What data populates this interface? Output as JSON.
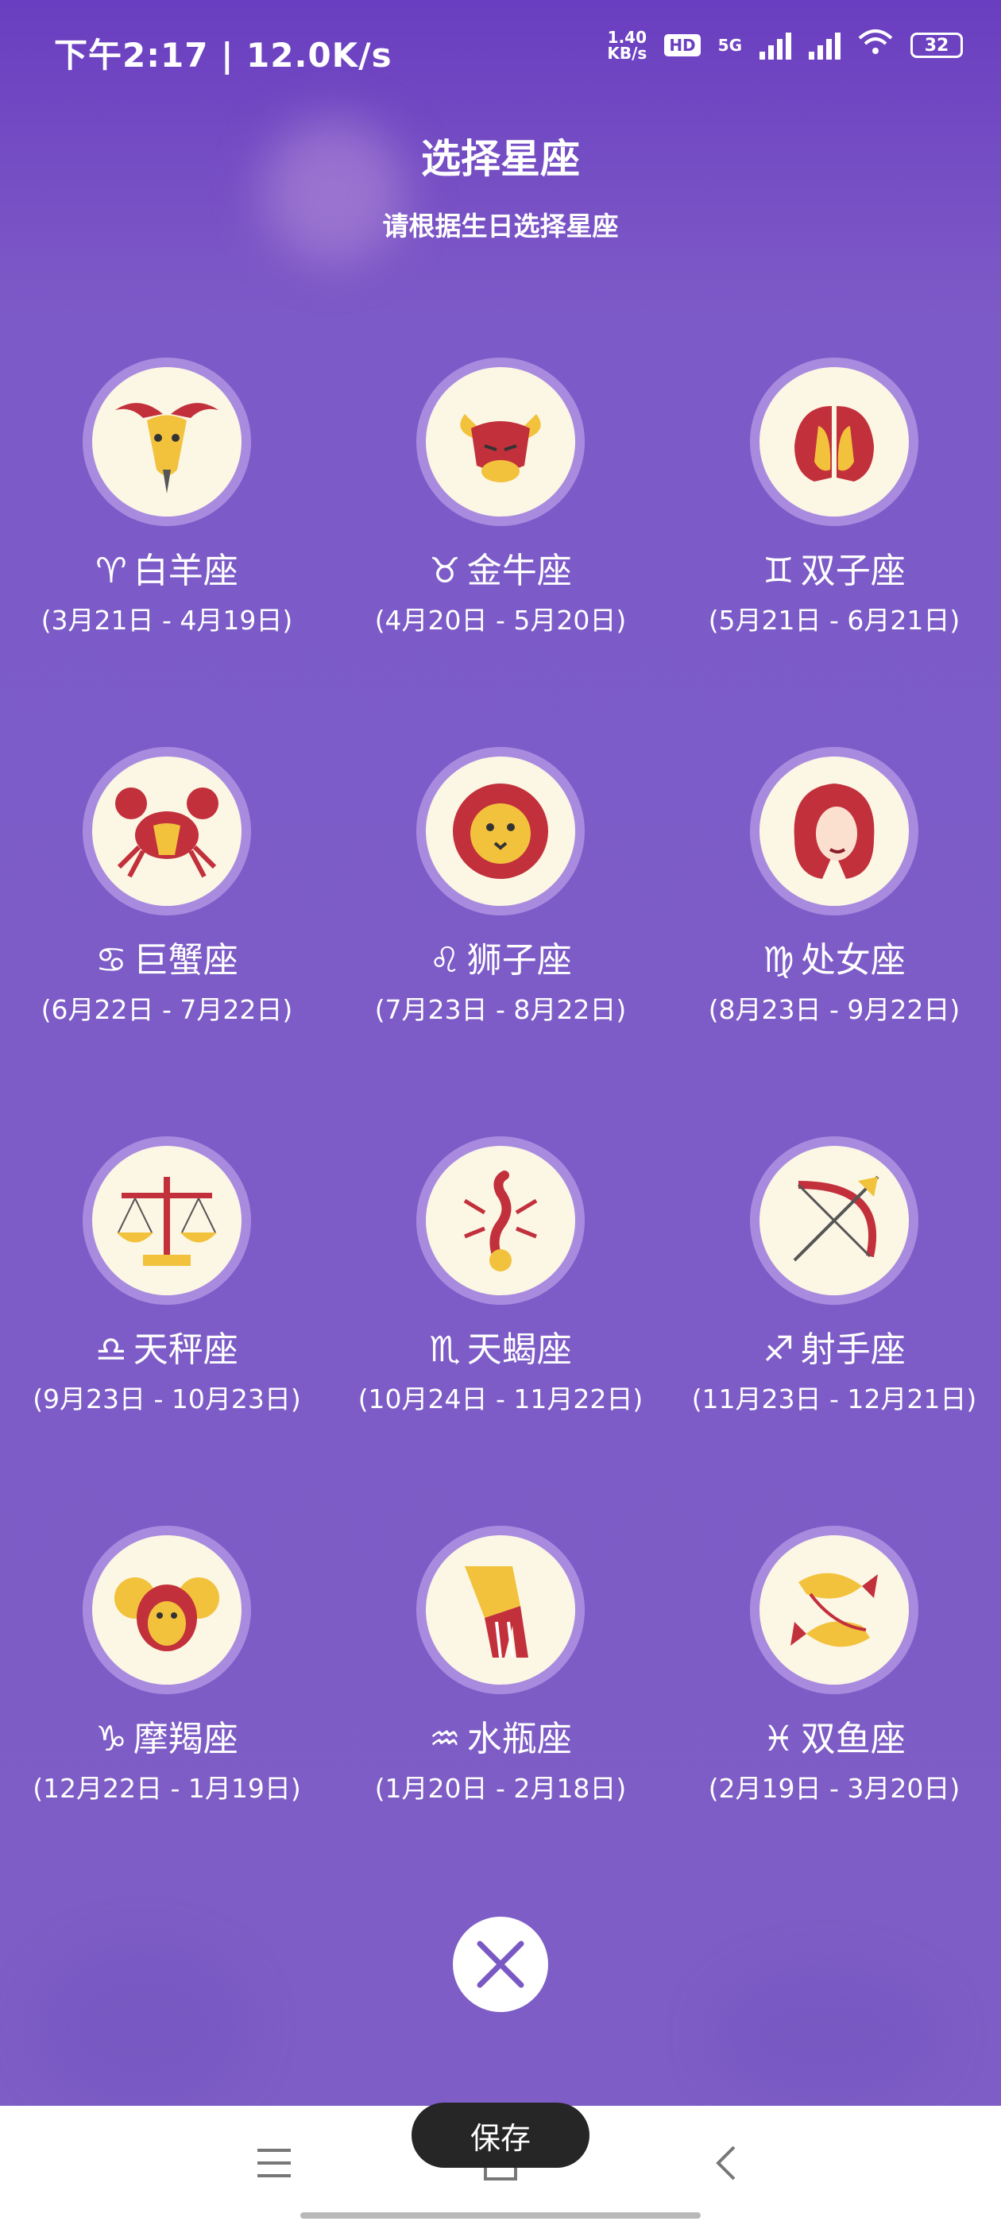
{
  "status_bar": {
    "time": "下午2:17 | 12.0K/s",
    "net_speed_value": "1.40",
    "net_speed_unit": "KB/s",
    "hd": "HD",
    "net_5g": "5G",
    "battery": "32"
  },
  "header": {
    "title": "选择星座",
    "subtitle": "请根据生日选择星座"
  },
  "signs": [
    {
      "symbol": "♈",
      "name": "白羊座",
      "dates": "(3月21日 - 4月19日)",
      "icon": "aries-ram-icon"
    },
    {
      "symbol": "♉",
      "name": "金牛座",
      "dates": "(4月20日 - 5月20日)",
      "icon": "taurus-bull-icon"
    },
    {
      "symbol": "♊",
      "name": "双子座",
      "dates": "(5月21日 - 6月21日)",
      "icon": "gemini-twins-icon"
    },
    {
      "symbol": "♋",
      "name": "巨蟹座",
      "dates": "(6月22日 - 7月22日)",
      "icon": "cancer-crab-icon"
    },
    {
      "symbol": "♌",
      "name": "狮子座",
      "dates": "(7月23日 - 8月22日)",
      "icon": "leo-lion-icon"
    },
    {
      "symbol": "♍",
      "name": "处女座",
      "dates": "(8月23日 - 9月22日)",
      "icon": "virgo-maiden-icon"
    },
    {
      "symbol": "♎",
      "name": "天秤座",
      "dates": "(9月23日 - 10月23日)",
      "icon": "libra-scales-icon"
    },
    {
      "symbol": "♏",
      "name": "天蝎座",
      "dates": "(10月24日 - 11月22日)",
      "icon": "scorpio-scorpion-icon"
    },
    {
      "symbol": "♐",
      "name": "射手座",
      "dates": "(11月23日 - 12月21日)",
      "icon": "sagittarius-bow-icon"
    },
    {
      "symbol": "♑",
      "name": "摩羯座",
      "dates": "(12月22日 - 1月19日)",
      "icon": "capricorn-goat-icon"
    },
    {
      "symbol": "♒",
      "name": "水瓶座",
      "dates": "(1月20日 - 2月18日)",
      "icon": "aquarius-water-icon"
    },
    {
      "symbol": "♓",
      "name": "双鱼座",
      "dates": "(2月19日 - 3月20日)",
      "icon": "pisces-fish-icon"
    }
  ],
  "actions": {
    "save": "保存"
  },
  "colors": {
    "background": "#7b58c6",
    "ring": "#a88bdf",
    "icon_bg": "#fcf6e4",
    "icon_red": "#c2303b",
    "icon_yellow": "#f2c23c",
    "close_x": "#7a58c4"
  }
}
